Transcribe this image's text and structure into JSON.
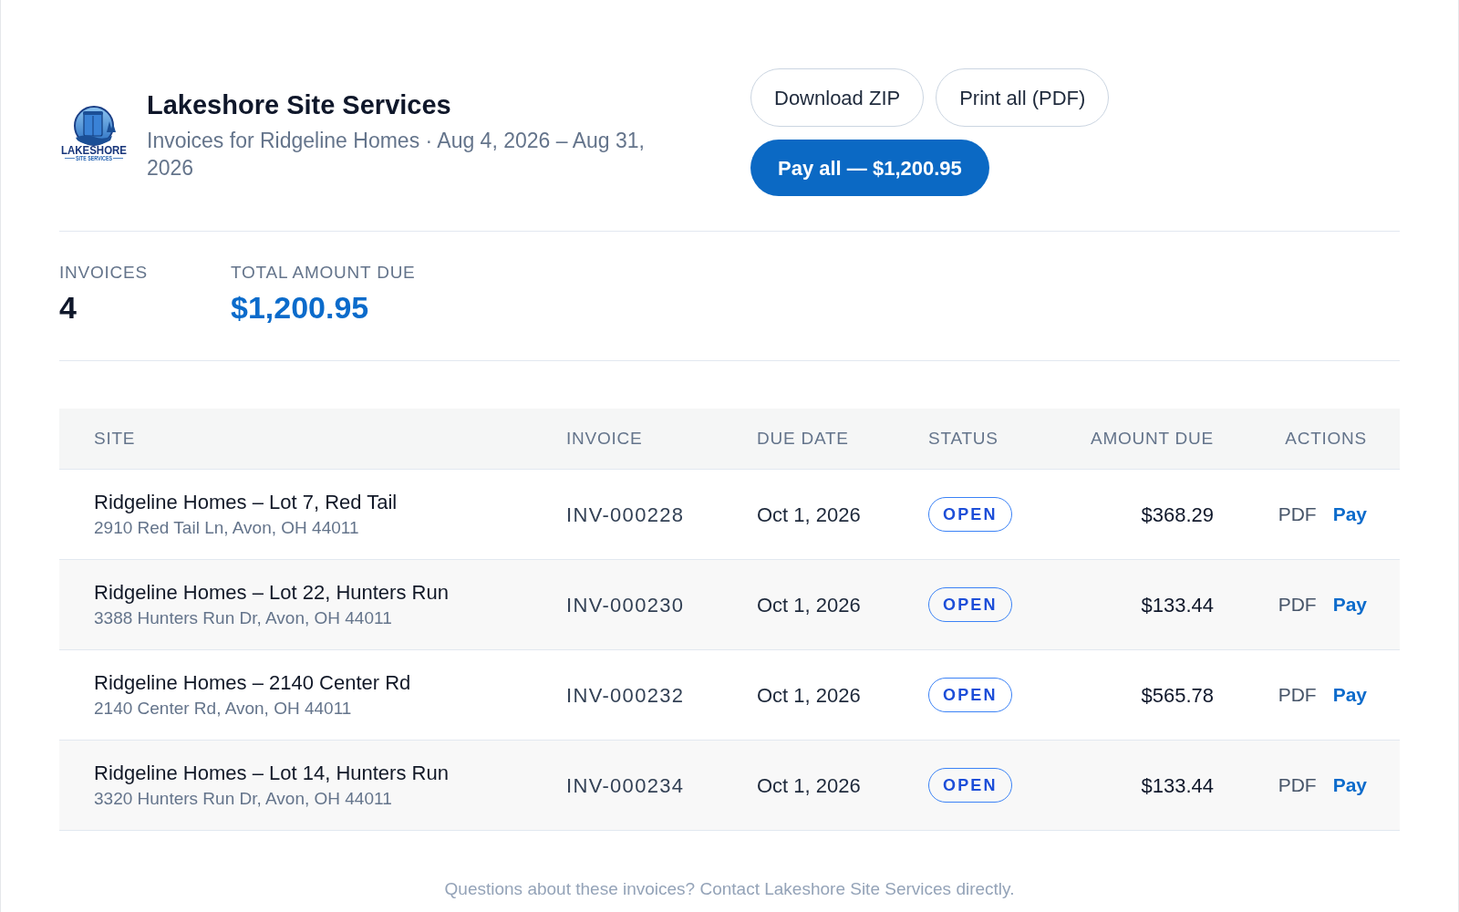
{
  "company": {
    "logo": {
      "wordmark": "LAKESHORE",
      "tagline": "SITE SERVICES"
    },
    "name": "Lakeshore Site Services",
    "subtitle": "Invoices for Ridgeline Homes · Aug 4, 2026 – Aug 31, 2026"
  },
  "actions": [
    {
      "label": "Download ZIP",
      "kind": "outline"
    },
    {
      "label": "Print all (PDF)",
      "kind": "outline"
    },
    {
      "label": "Pay all — $1,200.95",
      "kind": "primary"
    }
  ],
  "summary": [
    {
      "label": "INVOICES",
      "value": "4",
      "kind": "count"
    },
    {
      "label": "TOTAL AMOUNT DUE",
      "value": "$1,200.95",
      "kind": "money"
    }
  ],
  "table": {
    "columns": [
      "SITE",
      "INVOICE",
      "DUE DATE",
      "STATUS",
      "AMOUNT DUE",
      "ACTIONS"
    ],
    "rows": [
      {
        "site": "Ridgeline Homes – Lot 7, Red Tail",
        "address": "2910 Red Tail Ln, Avon, OH 44011",
        "invoice": "INV-000228",
        "due_date": "Oct 1, 2026",
        "status": "OPEN",
        "amount": "$368.29",
        "actions": [
          {
            "label": "PDF",
            "kind": "document"
          },
          {
            "label": "Pay",
            "kind": "pay"
          }
        ]
      },
      {
        "site": "Ridgeline Homes – Lot 22, Hunters Run",
        "address": "3388 Hunters Run Dr, Avon, OH 44011",
        "invoice": "INV-000230",
        "due_date": "Oct 1, 2026",
        "status": "OPEN",
        "amount": "$133.44",
        "actions": [
          {
            "label": "PDF",
            "kind": "document"
          },
          {
            "label": "Pay",
            "kind": "pay"
          }
        ]
      },
      {
        "site": "Ridgeline Homes – 2140 Center Rd",
        "address": "2140 Center Rd, Avon, OH 44011",
        "invoice": "INV-000232",
        "due_date": "Oct 1, 2026",
        "status": "OPEN",
        "amount": "$565.78",
        "actions": [
          {
            "label": "PDF",
            "kind": "document"
          },
          {
            "label": "Pay",
            "kind": "pay"
          }
        ]
      },
      {
        "site": "Ridgeline Homes – Lot 14, Hunters Run",
        "address": "3320 Hunters Run Dr, Avon, OH 44011",
        "invoice": "INV-000234",
        "due_date": "Oct 1, 2026",
        "status": "OPEN",
        "amount": "$133.44",
        "actions": [
          {
            "label": "PDF",
            "kind": "document"
          },
          {
            "label": "Pay",
            "kind": "pay"
          }
        ]
      }
    ]
  },
  "footer": "Questions about these invoices? Contact Lakeshore Site Services directly."
}
